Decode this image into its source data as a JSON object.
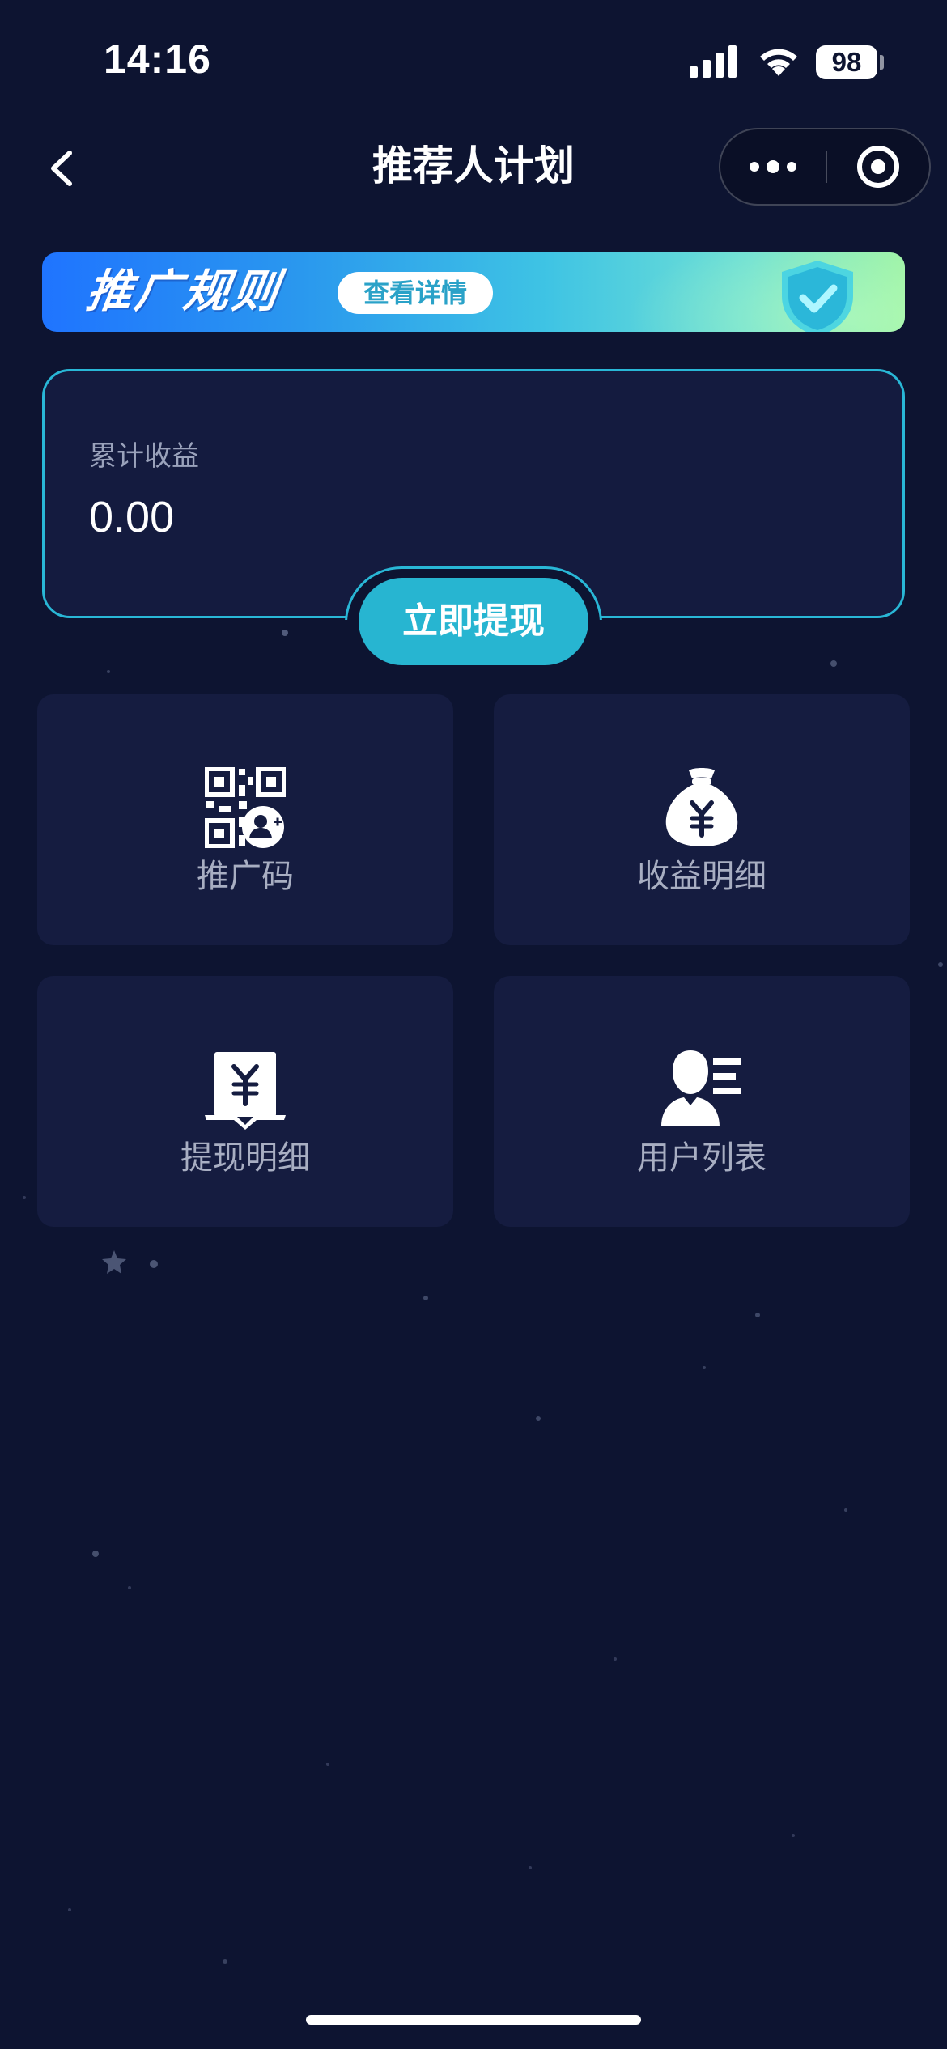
{
  "status_bar": {
    "time": "14:16",
    "battery": "98",
    "icons": [
      "signal-icon",
      "wifi-icon",
      "battery-icon"
    ]
  },
  "nav": {
    "title": "推荐人计划",
    "icons": [
      "back-arrow-icon",
      "more-dots-icon",
      "miniprogram-close-icon"
    ]
  },
  "banner": {
    "title": "推广规则",
    "detail_label": "查看详情",
    "icon": "shield-check-icon"
  },
  "earnings": {
    "label": "累计收益",
    "value": "0.00",
    "withdraw_label": "立即提现"
  },
  "menu": [
    {
      "label": "推广码",
      "icon": "qr-code-user-icon"
    },
    {
      "label": "收益明细",
      "icon": "money-bag-icon"
    },
    {
      "label": "提现明细",
      "icon": "withdraw-yuan-icon"
    },
    {
      "label": "用户列表",
      "icon": "user-list-icon"
    }
  ],
  "colors": {
    "background": "#0d1431",
    "card": "#151c40",
    "accent": "#29b7d6",
    "label": "#a8aec2"
  }
}
